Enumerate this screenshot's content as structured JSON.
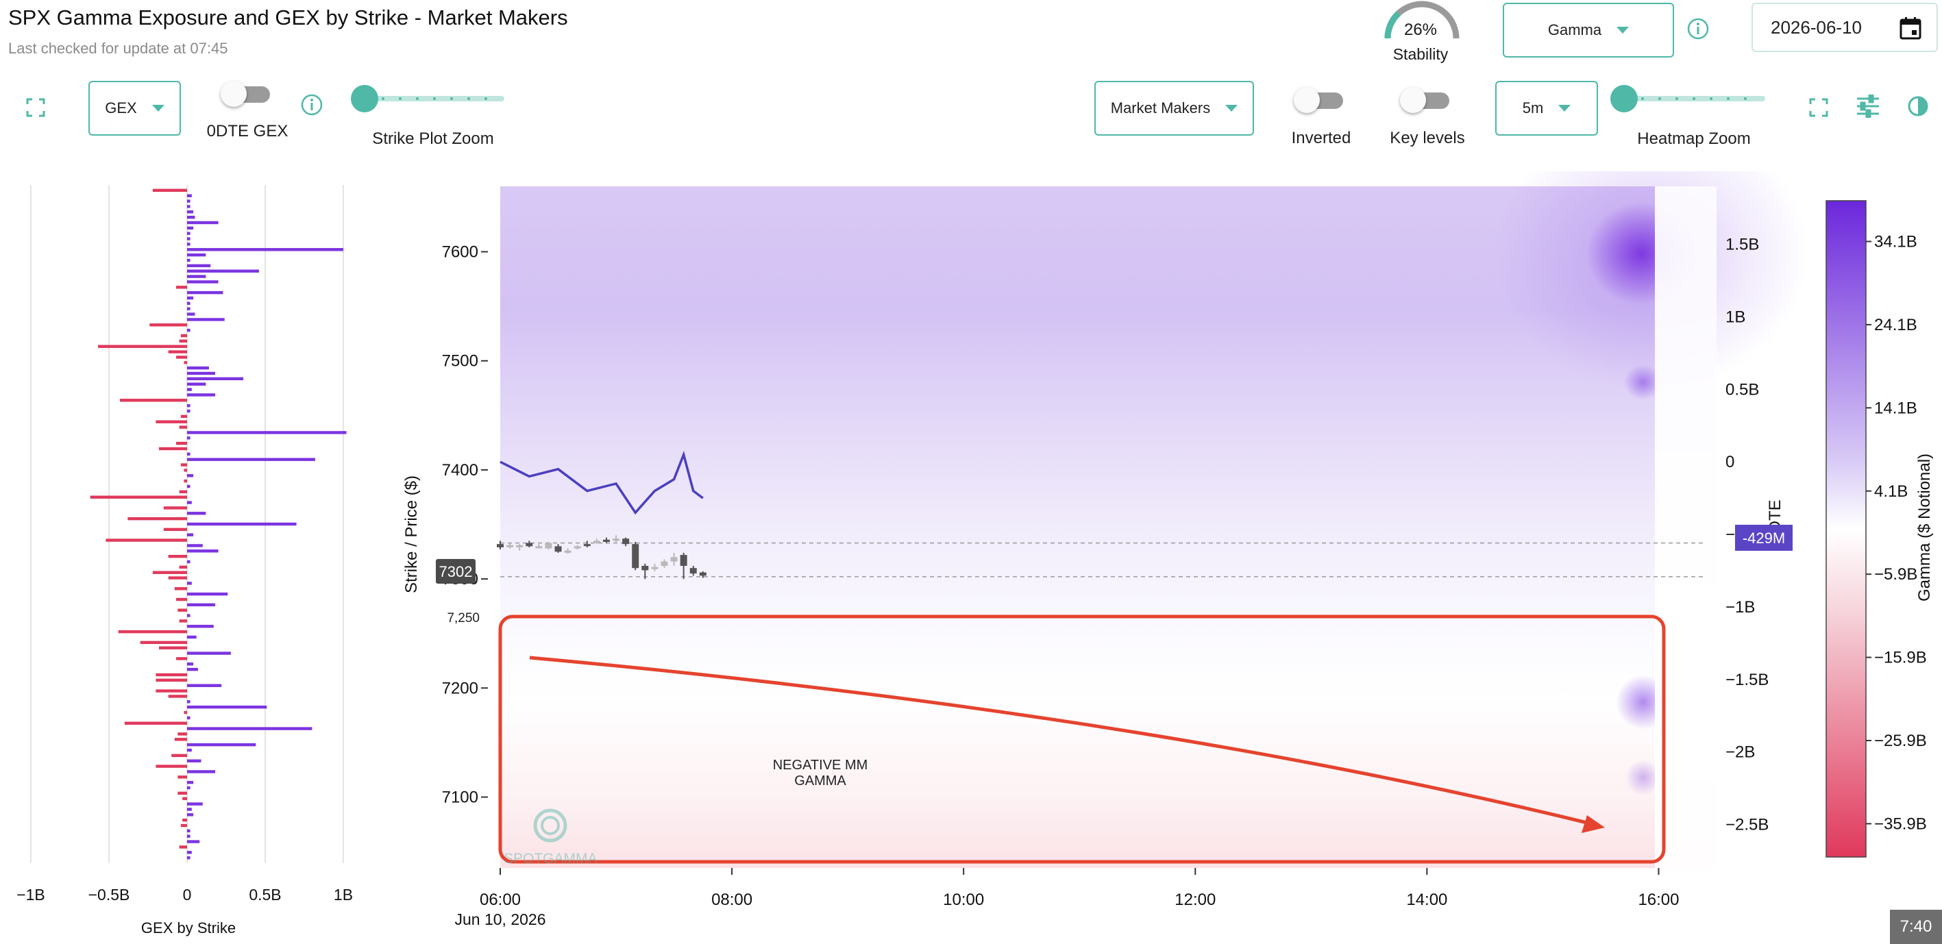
{
  "header": {
    "title": "SPX Gamma Exposure and GEX by Strike - Market Makers",
    "subtitle": "Last checked for update at 07:45"
  },
  "stability": {
    "value_label": "26%",
    "value": 0.26,
    "label": "Stability"
  },
  "controls": {
    "measure_dropdown": "Gamma",
    "date_value": "2026-06-10",
    "gex_dropdown": "GEX",
    "zero_dte_label": "0DTE GEX",
    "strike_zoom_label": "Strike Plot Zoom",
    "participant_dropdown": "Market Makers",
    "inverted_label": "Inverted",
    "key_levels_label": "Key levels",
    "interval_dropdown": "5m",
    "heatmap_zoom_label": "Heatmap Zoom"
  },
  "icons": {
    "fullscreen_left": "fullscreen-icon",
    "info_left": "info-icon",
    "info_top": "info-icon",
    "calendar": "calendar-icon",
    "fullscreen_right": "fullscreen-icon",
    "tune": "tune-icon",
    "contrast": "contrast-icon"
  },
  "colors": {
    "accent": "#4fb8a6",
    "positive": "#7b34e0",
    "negative": "#e0395c",
    "price_line": "#4b3fbf",
    "annotation": "#e5432e"
  },
  "chart_data": [
    {
      "type": "bar",
      "orientation": "horizontal",
      "xlabel": "GEX by Strike",
      "x_ticks": [
        "−1B",
        "−0.5B",
        "0",
        "0.5B",
        "1B"
      ],
      "xlim": [
        -1.1,
        1.1
      ],
      "strike_range": [
        7030,
        7660
      ],
      "bars": [
        [
          7655,
          -0.22
        ],
        [
          7650,
          0.03
        ],
        [
          7645,
          0.02
        ],
        [
          7640,
          0.02
        ],
        [
          7635,
          0.04
        ],
        [
          7630,
          0.05
        ],
        [
          7625,
          0.2
        ],
        [
          7620,
          0.04
        ],
        [
          7615,
          0.02
        ],
        [
          7610,
          0.02
        ],
        [
          7605,
          0.02
        ],
        [
          7600,
          1.0
        ],
        [
          7595,
          0.12
        ],
        [
          7590,
          0.02
        ],
        [
          7585,
          0.15
        ],
        [
          7580,
          0.46
        ],
        [
          7575,
          0.12
        ],
        [
          7570,
          0.2
        ],
        [
          7565,
          -0.07
        ],
        [
          7560,
          0.23
        ],
        [
          7555,
          0.04
        ],
        [
          7550,
          0.02
        ],
        [
          7545,
          0.02
        ],
        [
          7540,
          0.05
        ],
        [
          7535,
          0.24
        ],
        [
          7530,
          -0.24
        ],
        [
          7525,
          0.02
        ],
        [
          7520,
          -0.04
        ],
        [
          7515,
          -0.05
        ],
        [
          7510,
          -0.57
        ],
        [
          7505,
          -0.12
        ],
        [
          7500,
          -0.07
        ],
        [
          7495,
          -0.02
        ],
        [
          7490,
          0.14
        ],
        [
          7485,
          0.18
        ],
        [
          7480,
          0.36
        ],
        [
          7475,
          0.12
        ],
        [
          7470,
          0.03
        ],
        [
          7465,
          0.18
        ],
        [
          7460,
          -0.43
        ],
        [
          7455,
          0.02
        ],
        [
          7450,
          0.02
        ],
        [
          7445,
          -0.04
        ],
        [
          7440,
          -0.2
        ],
        [
          7435,
          -0.05
        ],
        [
          7430,
          1.02
        ],
        [
          7425,
          0.02
        ],
        [
          7420,
          -0.07
        ],
        [
          7415,
          -0.18
        ],
        [
          7410,
          0.02
        ],
        [
          7405,
          0.82
        ],
        [
          7400,
          -0.04
        ],
        [
          7395,
          -0.02
        ],
        [
          7390,
          0.04
        ],
        [
          7385,
          -0.02
        ],
        [
          7380,
          0.02
        ],
        [
          7375,
          -0.05
        ],
        [
          7370,
          -0.62
        ],
        [
          7365,
          0.03
        ],
        [
          7360,
          -0.15
        ],
        [
          7355,
          0.12
        ],
        [
          7350,
          -0.38
        ],
        [
          7345,
          0.7
        ],
        [
          7340,
          -0.15
        ],
        [
          7335,
          0.04
        ],
        [
          7330,
          -0.52
        ],
        [
          7325,
          0.1
        ],
        [
          7320,
          0.2
        ],
        [
          7315,
          -0.12
        ],
        [
          7310,
          0.02
        ],
        [
          7305,
          -0.05
        ],
        [
          7300,
          -0.22
        ],
        [
          7295,
          -0.12
        ],
        [
          7290,
          0.03
        ],
        [
          7285,
          -0.08
        ],
        [
          7280,
          0.26
        ],
        [
          7275,
          -0.07
        ],
        [
          7270,
          0.18
        ],
        [
          7265,
          -0.06
        ],
        [
          7260,
          0.02
        ],
        [
          7255,
          -0.05
        ],
        [
          7250,
          0.17
        ],
        [
          7245,
          -0.44
        ],
        [
          7240,
          0.06
        ],
        [
          7235,
          -0.3
        ],
        [
          7230,
          -0.18
        ],
        [
          7225,
          0.28
        ],
        [
          7220,
          -0.07
        ],
        [
          7215,
          0.04
        ],
        [
          7210,
          0.07
        ],
        [
          7205,
          -0.2
        ],
        [
          7200,
          -0.2
        ],
        [
          7195,
          0.22
        ],
        [
          7190,
          -0.2
        ],
        [
          7185,
          -0.12
        ],
        [
          7180,
          0.02
        ],
        [
          7175,
          0.51
        ],
        [
          7170,
          -0.02
        ],
        [
          7165,
          0.02
        ],
        [
          7160,
          -0.4
        ],
        [
          7155,
          0.8
        ],
        [
          7150,
          -0.06
        ],
        [
          7145,
          -0.08
        ],
        [
          7140,
          0.44
        ],
        [
          7135,
          0.03
        ],
        [
          7130,
          -0.1
        ],
        [
          7125,
          0.09
        ],
        [
          7120,
          -0.2
        ],
        [
          7115,
          0.18
        ],
        [
          7110,
          -0.06
        ],
        [
          7105,
          0.04
        ],
        [
          7100,
          0.02
        ],
        [
          7095,
          -0.06
        ],
        [
          7090,
          -0.03
        ],
        [
          7085,
          0.1
        ],
        [
          7080,
          0.03
        ],
        [
          7075,
          0.04
        ],
        [
          7070,
          -0.03
        ],
        [
          7065,
          -0.04
        ],
        [
          7060,
          0.02
        ],
        [
          7055,
          0.02
        ],
        [
          7050,
          0.08
        ],
        [
          7045,
          -0.05
        ],
        [
          7040,
          0.03
        ],
        [
          7035,
          0.02
        ]
      ]
    },
    {
      "type": "heatmap",
      "ylabel": "Strike / Price ($)",
      "y_ticks": [
        "7600",
        "7500",
        "7400",
        "7300",
        "7200",
        "7100"
      ],
      "ylim": [
        7035,
        7660
      ],
      "x_ticks": [
        "06:00",
        "08:00",
        "10:00",
        "12:00",
        "14:00",
        "16:00"
      ],
      "x_range": [
        "06:00",
        "16:30"
      ],
      "x_date_label": "Jun 10, 2026",
      "right_axis_ticks": [
        "1.5B",
        "1B",
        "0.5B",
        "0",
        "−0.5B",
        "−1B",
        "−1.5B",
        "−2B",
        "−2.5B"
      ],
      "right_axis_range": [
        -2.8,
        1.9
      ],
      "right_axis_label": "0DTE",
      "current_gex_label": "-429M",
      "current_gex_value": -0.429,
      "price_label": "7302",
      "strike_label": "7,250",
      "colorbar_ticks": [
        "34.1B",
        "24.1B",
        "14.1B",
        "4.1B",
        "−5.9B",
        "−15.9B",
        "−25.9B",
        "−35.9B"
      ],
      "colorbar_label": "Gamma ($ Notional)",
      "annotation_text_1": "NEGATIVE MM",
      "annotation_text_2": "GAMMA",
      "watermark": "SPOTGAMMA",
      "reference_lines": [
        7333,
        7302
      ],
      "gex_line": [
        [
          "06:00",
          0.0
        ],
        [
          "06:15",
          -0.1
        ],
        [
          "06:30",
          -0.05
        ],
        [
          "06:45",
          -0.2
        ],
        [
          "07:00",
          -0.15
        ],
        [
          "07:10",
          -0.35
        ],
        [
          "07:20",
          -0.2
        ],
        [
          "07:30",
          -0.12
        ],
        [
          "07:35",
          0.05
        ],
        [
          "07:40",
          -0.2
        ],
        [
          "07:45",
          -0.25
        ]
      ],
      "candles": [
        [
          "06:00",
          7332,
          7329,
          7335,
          7327
        ],
        [
          "06:05",
          7330,
          7331,
          7333,
          7328
        ],
        [
          "06:10",
          7329,
          7331,
          7332,
          7326
        ],
        [
          "06:15",
          7333,
          7330,
          7335,
          7329
        ],
        [
          "06:20",
          7330,
          7330,
          7332,
          7328
        ],
        [
          "06:25",
          7328,
          7333,
          7334,
          7327
        ],
        [
          "06:30",
          7330,
          7325,
          7332,
          7324
        ],
        [
          "06:35",
          7324,
          7326,
          7328,
          7323
        ],
        [
          "06:40",
          7328,
          7330,
          7331,
          7327
        ],
        [
          "06:45",
          7332,
          7331,
          7335,
          7329
        ],
        [
          "06:50",
          7333,
          7335,
          7337,
          7332
        ],
        [
          "06:55",
          7336,
          7334,
          7338,
          7333
        ],
        [
          "07:00",
          7335,
          7337,
          7340,
          7333
        ],
        [
          "07:05",
          7337,
          7332,
          7338,
          7330
        ],
        [
          "07:10",
          7332,
          7310,
          7334,
          7308
        ],
        [
          "07:15",
          7312,
          7308,
          7314,
          7300
        ],
        [
          "07:20",
          7309,
          7311,
          7314,
          7307
        ],
        [
          "07:25",
          7312,
          7316,
          7318,
          7310
        ],
        [
          "07:30",
          7316,
          7320,
          7324,
          7312
        ],
        [
          "07:35",
          7322,
          7312,
          7324,
          7300
        ],
        [
          "07:40",
          7310,
          7305,
          7312,
          7303
        ],
        [
          "07:45",
          7306,
          7303,
          7307,
          7301
        ]
      ]
    }
  ],
  "footer": {
    "time_badge": "7:40"
  }
}
